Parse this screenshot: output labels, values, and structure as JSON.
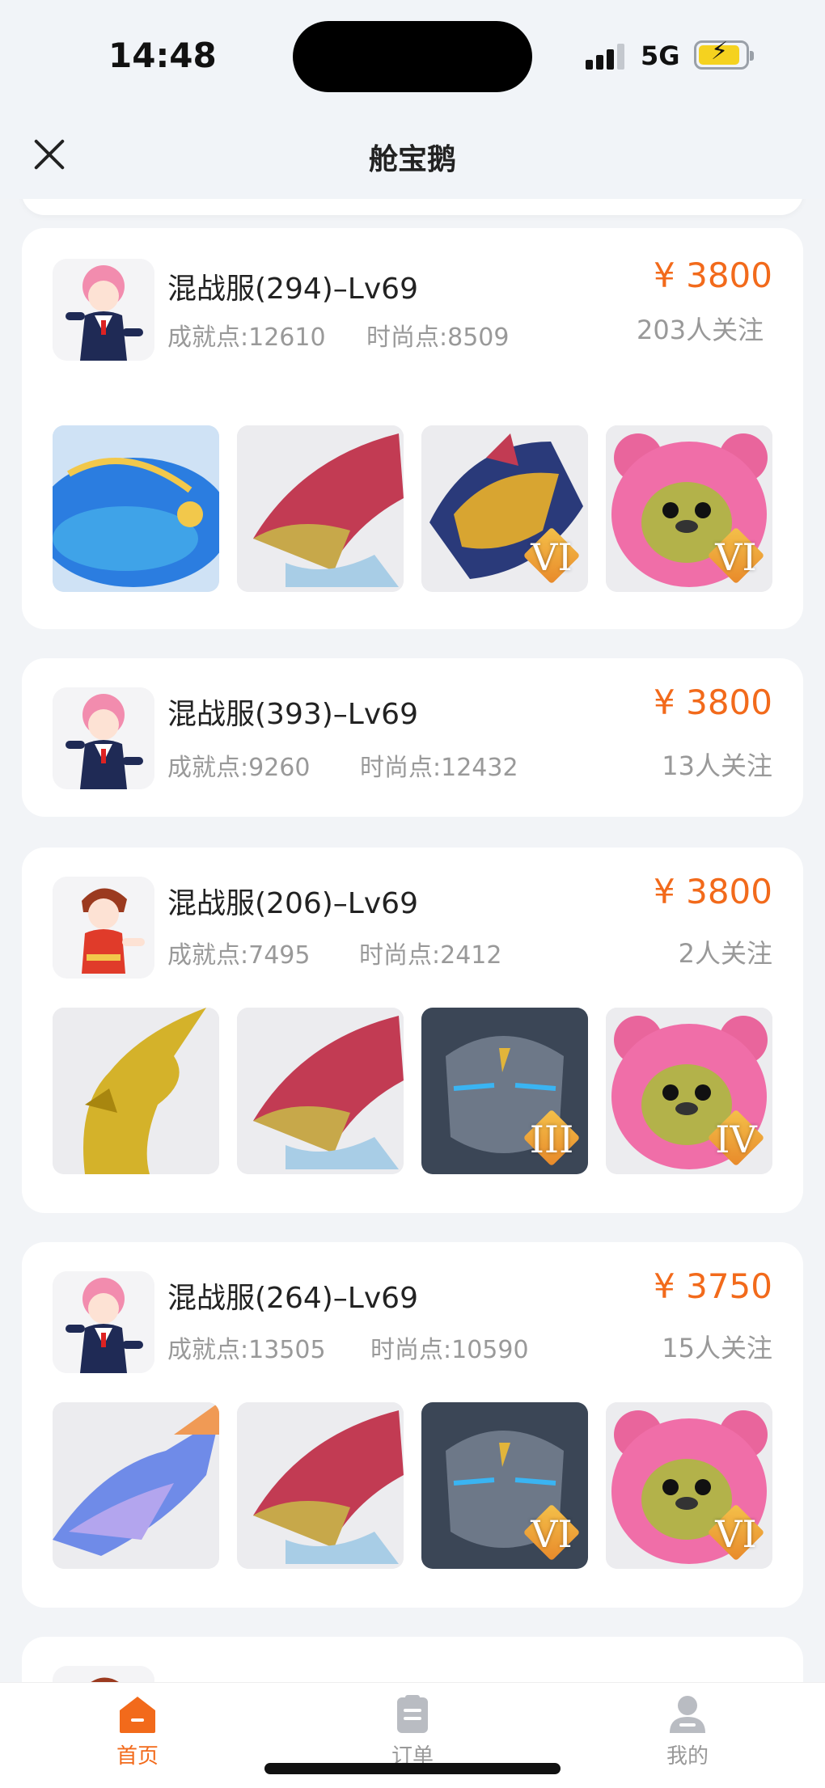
{
  "status_bar": {
    "time": "14:48",
    "network": "5G"
  },
  "header": {
    "title": "舱宝鹅"
  },
  "colors": {
    "accent": "#f26a1b",
    "muted": "#999999",
    "background": "#f2f4f7"
  },
  "listings": [
    {
      "name": "混战服(294)–Lv69",
      "achievement": "成就点:12610",
      "fashion": "时尚点:8509",
      "price": "¥ 3800",
      "followers": "203人关注",
      "items": [
        {
          "icon": "whale-mount-icon",
          "badge": ""
        },
        {
          "icon": "red-dragon-icon",
          "badge": ""
        },
        {
          "icon": "gold-dragon-icon",
          "badge": "VI"
        },
        {
          "icon": "pink-bear-icon",
          "badge": "VI"
        }
      ]
    },
    {
      "name": "混战服(393)–Lv69",
      "achievement": "成就点:9260",
      "fashion": "时尚点:12432",
      "price": "¥ 3800",
      "followers": "13人关注",
      "items": []
    },
    {
      "name": "混战服(206)–Lv69",
      "achievement": "成就点:7495",
      "fashion": "时尚点:2412",
      "price": "¥ 3800",
      "followers": "2人关注",
      "items": [
        {
          "icon": "golden-phoenix-icon",
          "badge": ""
        },
        {
          "icon": "red-dragon-icon",
          "badge": ""
        },
        {
          "icon": "stone-golem-icon",
          "badge": "III"
        },
        {
          "icon": "pink-bear-icon",
          "badge": "IV"
        }
      ]
    },
    {
      "name": "混战服(264)–Lv69",
      "achievement": "成就点:13505",
      "fashion": "时尚点:10590",
      "price": "¥ 3750",
      "followers": "15人关注",
      "items": [
        {
          "icon": "ice-dragon-icon",
          "badge": ""
        },
        {
          "icon": "red-dragon-icon",
          "badge": ""
        },
        {
          "icon": "stone-golem-icon",
          "badge": "VI"
        },
        {
          "icon": "pink-bear-icon",
          "badge": "VI"
        }
      ]
    }
  ],
  "tabbar": {
    "home": "首页",
    "orders": "订单",
    "mine": "我的"
  }
}
